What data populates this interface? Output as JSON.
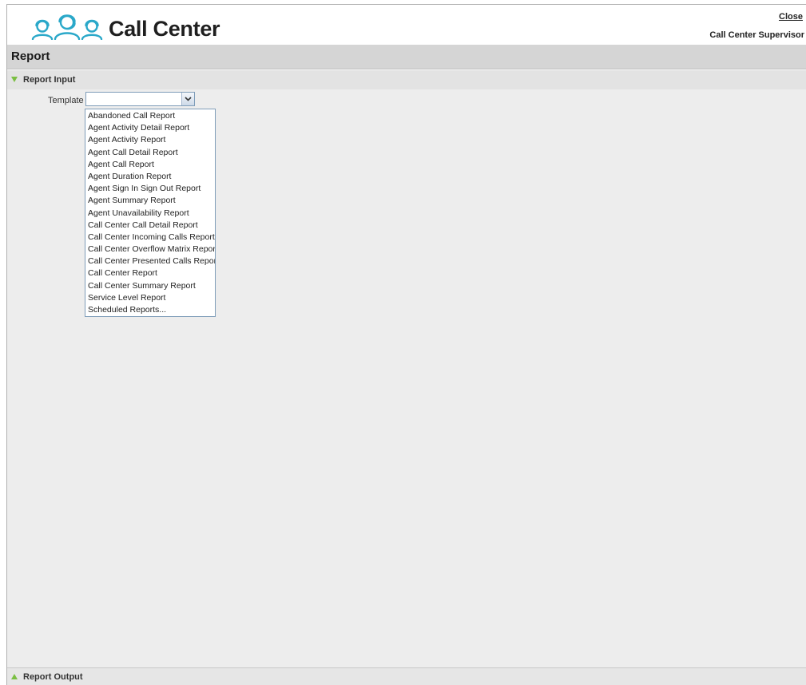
{
  "header": {
    "app_name": "Call Center",
    "close_label": "Close",
    "user_role": "Call Center Supervisor",
    "logo_icon": "agents-headset-icon",
    "brand_color": "#2aa8c9"
  },
  "page": {
    "title": "Report"
  },
  "report_input": {
    "label": "Report Input",
    "expanded": true,
    "template_label": "Template :",
    "template_value": "",
    "template_options": [
      "Abandoned Call Report",
      "Agent Activity Detail Report",
      "Agent Activity Report",
      "Agent Call Detail Report",
      "Agent Call Report",
      "Agent Duration Report",
      "Agent Sign In Sign Out Report",
      "Agent Summary Report",
      "Agent Unavailability Report",
      "Call Center Call Detail Report",
      "Call Center Incoming Calls Report",
      "Call Center Overflow Matrix Report",
      "Call Center Presented Calls Report",
      "Call Center Report",
      "Call Center Summary Report",
      "Service Level Report",
      "Scheduled Reports..."
    ]
  },
  "report_output": {
    "label": "Report Output",
    "expanded": false
  },
  "colors": {
    "accent_green": "#7bbf43",
    "title_bar": "#d5d5d5",
    "content_bg": "#ededed"
  }
}
